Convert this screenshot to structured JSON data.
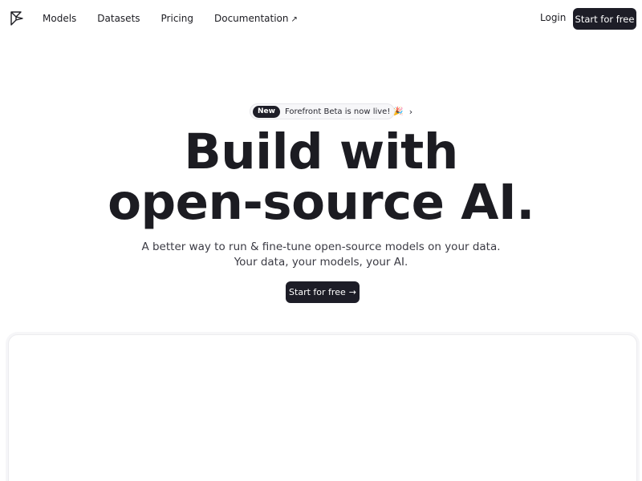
{
  "nav": {
    "logo_icon": "forefront-logo-icon",
    "links": [
      {
        "label": "Models"
      },
      {
        "label": "Datasets"
      },
      {
        "label": "Pricing"
      },
      {
        "label": "Documentation",
        "icon": "external-arrow-icon",
        "glyph": "↗"
      }
    ],
    "login_label": "Login",
    "cta_label": "Start for free"
  },
  "announcement": {
    "badge": "New",
    "text": "Forefront Beta is now live!",
    "emoji": "🎉",
    "chevron": "›"
  },
  "hero": {
    "headline_line1": "Build with",
    "headline_line2": "open-source AI.",
    "subtitle_line1": "A better way to run & fine-tune open-source models on your data.",
    "subtitle_line2": "Your data, your models, your AI.",
    "cta_label": "Start for free",
    "cta_arrow": "→"
  },
  "colors": {
    "primary_dark": "#1d1d27",
    "text": "#1c1c22",
    "background": "#ffffff"
  }
}
